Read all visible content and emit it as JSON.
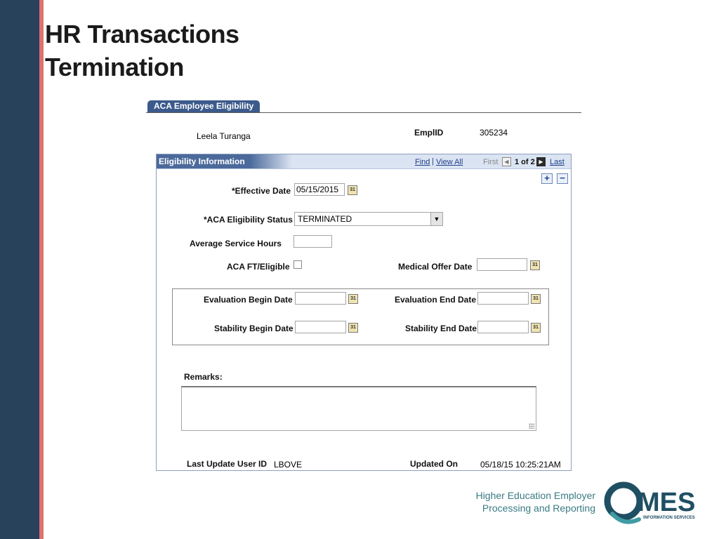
{
  "slide": {
    "title_line1": "HR Transactions",
    "title_line2": "Termination"
  },
  "page": {
    "tab_label": "ACA Employee Eligibility",
    "employee_name": "Leela Turanga",
    "emplid_label": "EmplID",
    "emplid_value": "305234"
  },
  "grid": {
    "title": "Eligibility Information",
    "find_label": "Find",
    "view_all_label": "View All",
    "separator": "|",
    "first_label": "First",
    "count_label": "1 of 2",
    "last_label": "Last",
    "add_row": "+",
    "delete_row": "−"
  },
  "form": {
    "effective_date_label": "*Effective Date",
    "effective_date_value": "05/15/2015",
    "eligibility_status_label": "*ACA Eligibility Status",
    "eligibility_status_value": "TERMINATED",
    "avg_service_hours_label": "Average Service Hours",
    "avg_service_hours_value": "",
    "ft_eligible_label": "ACA FT/Eligible",
    "ft_eligible_checked": false,
    "medical_offer_date_label": "Medical Offer Date",
    "medical_offer_date_value": "",
    "eval_begin_label": "Evaluation Begin Date",
    "eval_begin_value": "",
    "eval_end_label": "Evaluation End Date",
    "eval_end_value": "",
    "stab_begin_label": "Stability Begin Date",
    "stab_begin_value": "",
    "stab_end_label": "Stability End Date",
    "stab_end_value": "",
    "remarks_label": "Remarks:",
    "remarks_value": "",
    "calendar_icon_text": "31"
  },
  "audit": {
    "last_update_user_label": "Last Update User ID",
    "last_update_user_value": "LBOVE",
    "updated_on_label": "Updated On",
    "updated_on_value": "05/18/15 10:25:21AM"
  },
  "footer": {
    "line1": "Higher Education Employer",
    "line2": "Processing and Reporting",
    "logo_text": "MES",
    "logo_subtext": "INFORMATION SERVICES"
  },
  "colors": {
    "left_bar": "#29425c",
    "accent": "#e0706e",
    "tab": "#3c5a8c",
    "logo_primary": "#1f4f63",
    "logo_teal": "#3f9ca3"
  }
}
